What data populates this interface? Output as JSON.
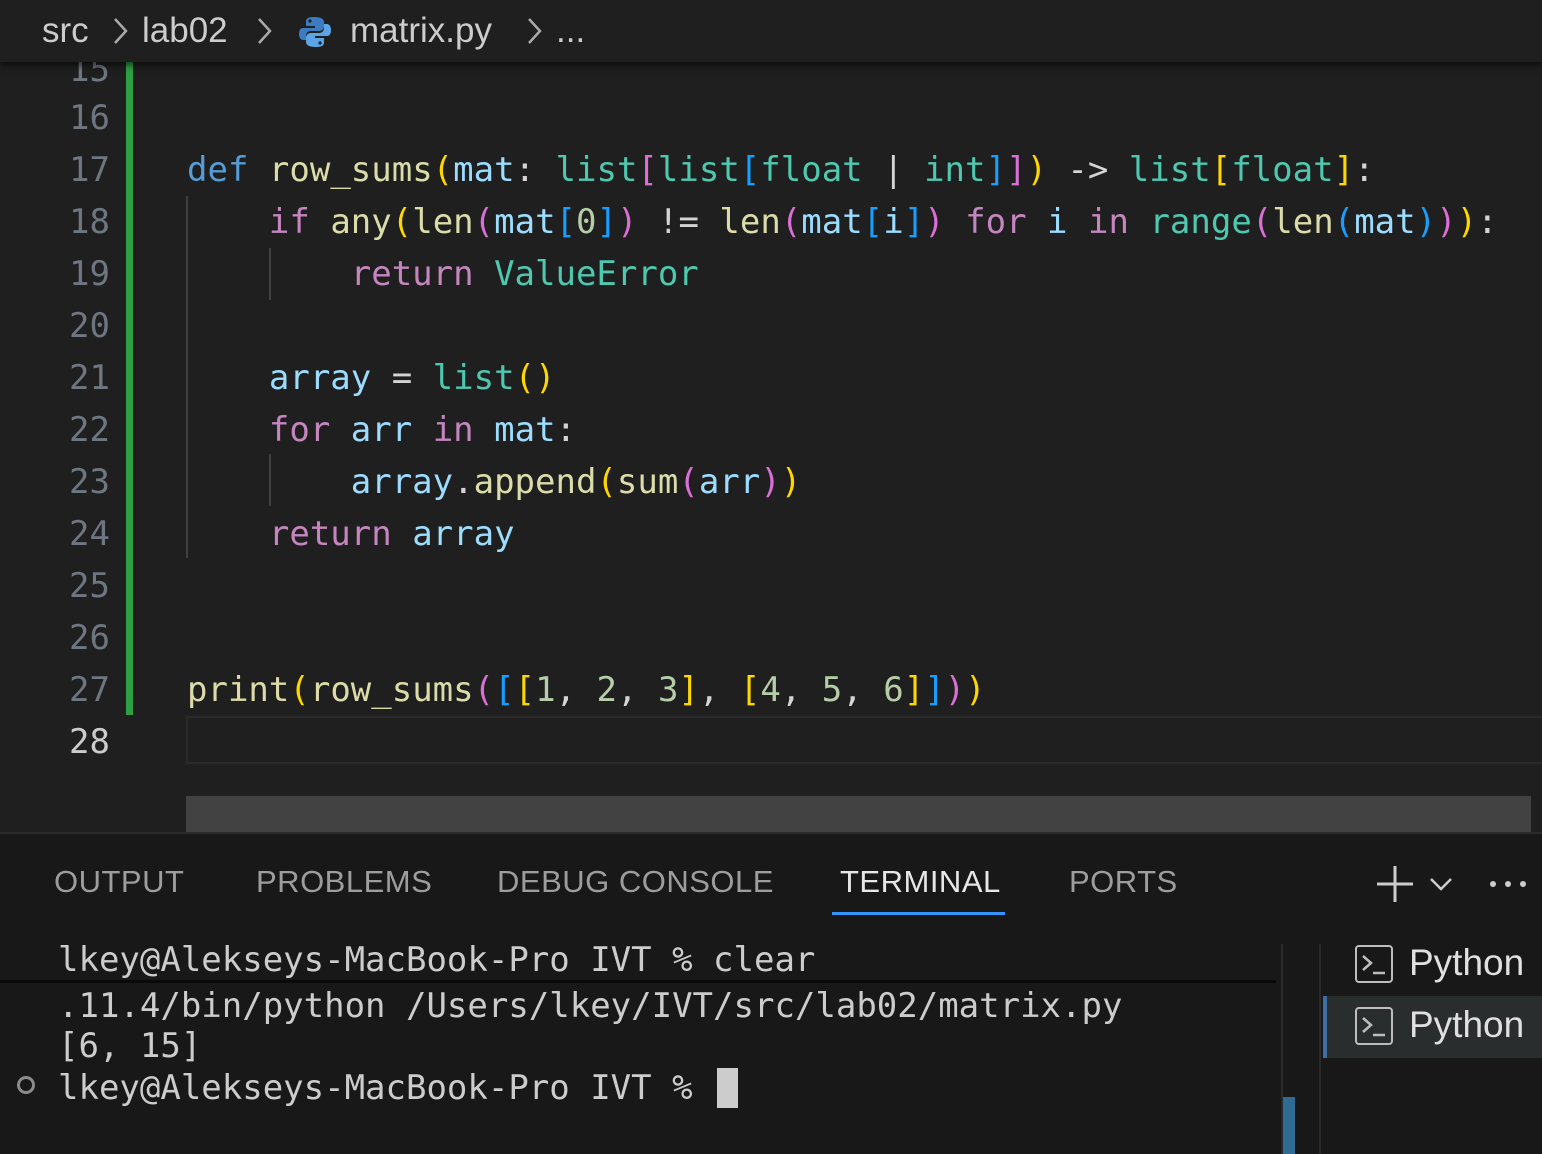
{
  "breadcrumb": {
    "items": [
      "src",
      "lab02",
      "matrix.py",
      "..."
    ],
    "file_icon": "python-icon"
  },
  "editor": {
    "line_numbers": [
      "15",
      "16",
      "17",
      "18",
      "19",
      "20",
      "21",
      "22",
      "23",
      "24",
      "25",
      "26",
      "27",
      "28"
    ],
    "active_line": "28",
    "code": [
      "",
      "",
      "def row_sums(mat: list[list[float | int]]) -> list[float]:",
      "    if any(len(mat[0]) != len(mat[i]) for i in range(len(mat))):",
      "        return ValueError",
      "",
      "    array = list()",
      "    for arr in mat:",
      "        array.append(sum(arr))",
      "    return array",
      "",
      "",
      "print(row_sums([[1, 2, 3], [4, 5, 6]]))",
      ""
    ]
  },
  "panel": {
    "tabs": [
      "OUTPUT",
      "PROBLEMS",
      "DEBUG CONSOLE",
      "TERMINAL",
      "PORTS"
    ],
    "active_tab": "TERMINAL",
    "actions": {
      "add": "+",
      "dropdown": "chevron-down-icon",
      "more": "⋯"
    }
  },
  "terminal": {
    "lines": [
      "lkey@Alekseys-MacBook-Pro IVT % clear",
      ".11.4/bin/python /Users/lkey/IVT/src/lab02/matrix.py",
      "[6, 15]",
      "lkey@Alekseys-MacBook-Pro IVT % "
    ],
    "instances": [
      "Python",
      "Python"
    ],
    "selected_instance": 1
  },
  "colors": {
    "accent": "#3794ff",
    "modified_gutter": "#2ea043",
    "background": "#1f1f1f"
  }
}
